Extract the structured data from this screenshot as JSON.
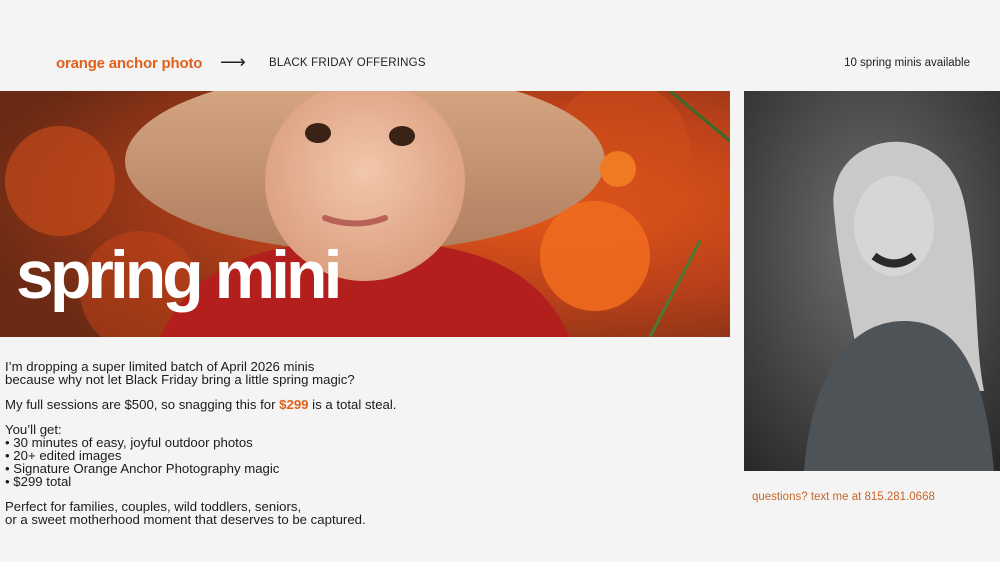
{
  "header": {
    "brand": "orange anchor photo",
    "arrow": "⟶",
    "offerings": "BLACK FRIDAY OFFERINGS",
    "availability": "10 spring minis available"
  },
  "hero": {
    "title": "spring mini"
  },
  "body": {
    "intro_line1": "I’m dropping a super limited batch of April 2026 minis",
    "intro_line2": "because why not let Black Friday bring a little spring magic?",
    "pricing_before": "My full sessions are $500, so snagging this for ",
    "pricing_price": "$299",
    "pricing_after": " is a total steal.",
    "includes_heading": "You’ll get:",
    "includes": [
      "• 30 minutes of easy, joyful outdoor photos",
      "• 20+ edited images",
      "• Signature Orange Anchor Photography magic",
      "• $299 total"
    ],
    "closing_line1": "Perfect for families, couples, wild toddlers, seniors,",
    "closing_line2": "or a sweet motherhood moment that deserves to be captured."
  },
  "contact": {
    "text": "questions? text me at 815.281.0668"
  },
  "colors": {
    "accent": "#e0611a",
    "contact": "#c8662a",
    "background": "#f4f4f4"
  }
}
